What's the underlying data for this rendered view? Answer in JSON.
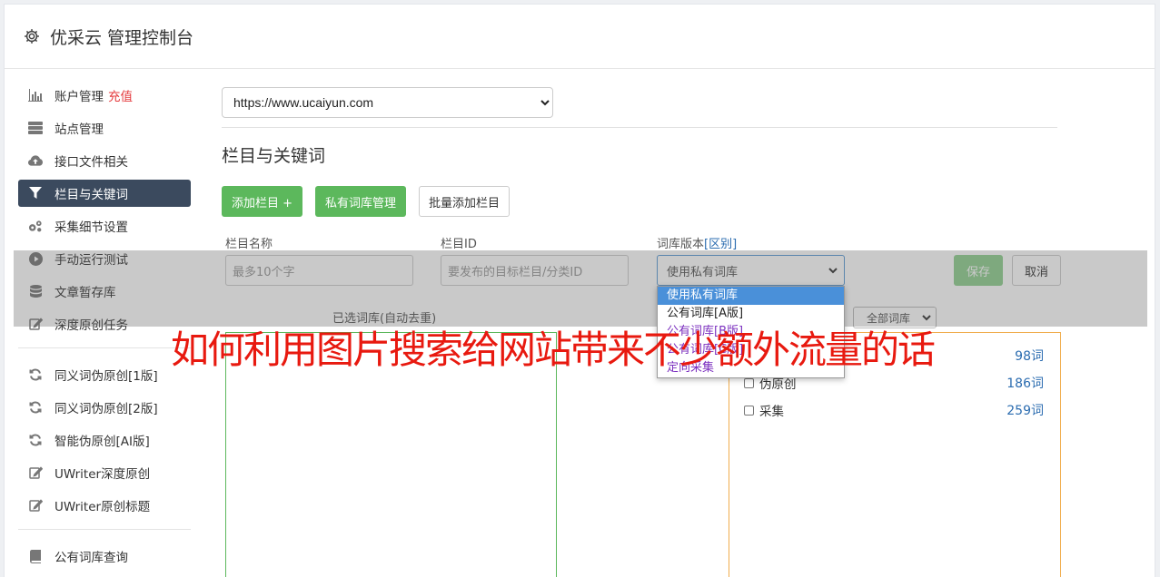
{
  "header": {
    "title": "优采云 管理控制台"
  },
  "sidebar": {
    "items": [
      {
        "label": "账户管理",
        "badge": "充值",
        "icon": "bar-chart-icon"
      },
      {
        "label": "站点管理",
        "icon": "server-icon"
      },
      {
        "label": "接口文件相关",
        "icon": "cloud-upload-icon"
      },
      {
        "label": "栏目与关键词",
        "icon": "filter-icon",
        "active": true
      },
      {
        "label": "采集细节设置",
        "icon": "gears-icon"
      },
      {
        "label": "手动运行测试",
        "icon": "play-circle-icon"
      },
      {
        "label": "文章暂存库",
        "icon": "database-icon"
      },
      {
        "label": "深度原创任务",
        "icon": "edit-icon"
      }
    ],
    "items2": [
      {
        "label": "同义词伪原创[1版]",
        "icon": "refresh-icon"
      },
      {
        "label": "同义词伪原创[2版]",
        "icon": "refresh-icon"
      },
      {
        "label": "智能伪原创[AI版]",
        "icon": "refresh-icon"
      },
      {
        "label": "UWriter深度原创",
        "icon": "edit-icon"
      },
      {
        "label": "UWriter原创标题",
        "icon": "edit-icon"
      }
    ],
    "items3": [
      {
        "label": "公有词库查询",
        "icon": "book-icon"
      }
    ]
  },
  "main": {
    "site_select": "https://www.ucaiyun.com",
    "section_title": "栏目与关键词",
    "buttons": {
      "add_column": "添加栏目 +",
      "private_lib": "私有词库管理",
      "batch_add": "批量添加栏目"
    },
    "form": {
      "name_label": "栏目名称",
      "name_placeholder": "最多10个字",
      "id_label": "栏目ID",
      "id_placeholder": "要发布的目标栏目/分类ID",
      "lib_label": "词库版本",
      "lib_link": "[区别]",
      "lib_value": "使用私有词库",
      "save": "保存",
      "cancel": "取消"
    },
    "dropdown_options": [
      "使用私有词库",
      "公有词库[A版]",
      "公有词库[B版]",
      "公有词库[C版]",
      "定向采集"
    ],
    "selected_libs_label": "已选词库(自动去重)",
    "lib_filter": "全部词库",
    "libs": [
      {
        "name": "",
        "count": "98词"
      },
      {
        "name": "伪原创",
        "count": "186词"
      },
      {
        "name": "采集",
        "count": "259词"
      }
    ]
  },
  "watermark": "如何利用图片搜索给网站带来不少额外流量的话",
  "colors": {
    "primary_green": "#5cb85c",
    "active_nav": "#3b4a5e",
    "link": "#2b6cb0",
    "watermark": "#e8190f"
  }
}
